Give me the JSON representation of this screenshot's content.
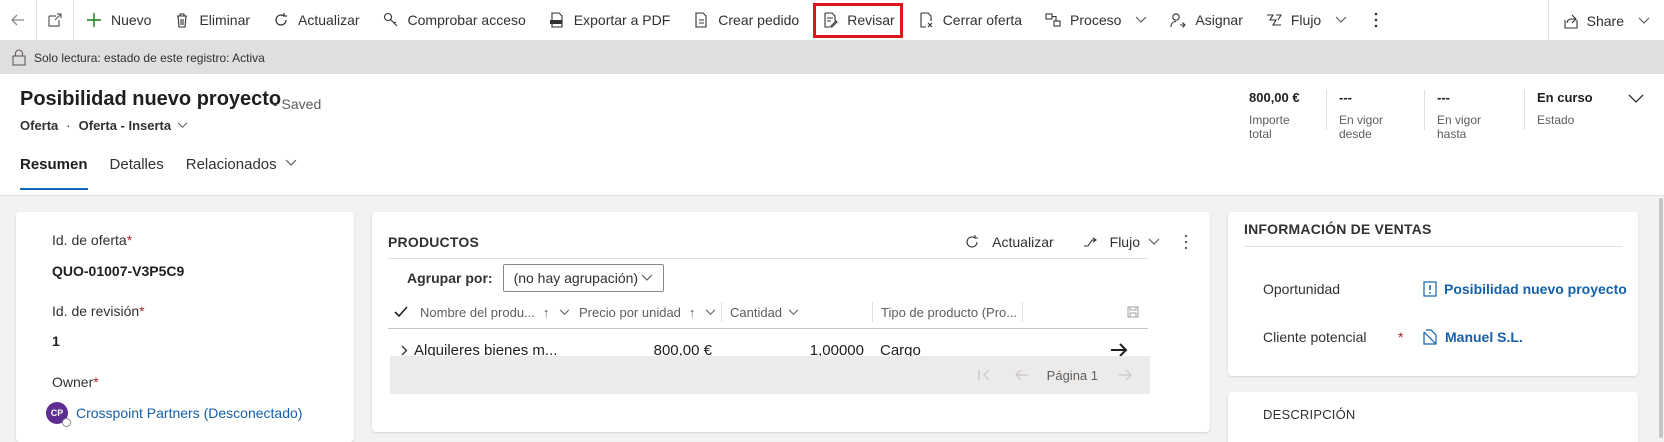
{
  "commandbar": {
    "items": [
      {
        "label": "Nuevo",
        "icon": "plus-icon"
      },
      {
        "label": "Eliminar",
        "icon": "trash-icon"
      },
      {
        "label": "Actualizar",
        "icon": "refresh-icon"
      },
      {
        "label": "Comprobar acceso",
        "icon": "key-icon"
      },
      {
        "label": "Exportar a PDF",
        "icon": "pdf-icon"
      },
      {
        "label": "Crear pedido",
        "icon": "document-icon"
      },
      {
        "label": "Revisar",
        "icon": "edit-document-icon"
      },
      {
        "label": "Cerrar oferta",
        "icon": "close-document-icon"
      },
      {
        "label": "Proceso",
        "icon": "process-icon"
      },
      {
        "label": "Asignar",
        "icon": "person-icon"
      },
      {
        "label": "Flujo",
        "icon": "flow-icon"
      }
    ],
    "share_label": "Share",
    "highlight_color": "#e0141d"
  },
  "readonly_bar": {
    "text": "Solo lectura: estado de este registro: Activa"
  },
  "header": {
    "title": "Posibilidad nuevo proyecto",
    "saved": "- Saved",
    "entity": "Oferta",
    "form": "Oferta - Inserta",
    "fields": [
      {
        "value": "800,00 €",
        "label": "Importe total"
      },
      {
        "value": "---",
        "label": "En vigor desde"
      },
      {
        "value": "---",
        "label": "En vigor hasta"
      },
      {
        "value": "En curso",
        "label": "Estado"
      }
    ],
    "tabs": [
      {
        "label": "Resumen",
        "active": true
      },
      {
        "label": "Detalles",
        "active": false
      },
      {
        "label": "Relacionados",
        "active": false
      }
    ]
  },
  "summary": {
    "quote_id_label": "Id. de oferta",
    "quote_id_value": "QUO-01007-V3P5C9",
    "revision_label": "Id. de revisión",
    "revision_value": "1",
    "owner_label": "Owner",
    "owner_initials": "CP",
    "owner_name": "Crosspoint Partners (Desconectado)",
    "required_mark": "*"
  },
  "products": {
    "title": "PRODUCTOS",
    "refresh_label": "Actualizar",
    "flow_label": "Flujo",
    "group_by_label": "Agrupar por:",
    "group_by_value": "(no hay agrupación)",
    "columns": [
      {
        "label": "Nombre del produ...",
        "sort": "↑"
      },
      {
        "label": "Precio por unidad",
        "sort": "↑"
      },
      {
        "label": "Cantidad",
        "sort": ""
      },
      {
        "label": "Tipo de producto (Pro...",
        "sort": ""
      }
    ],
    "rows": [
      {
        "name": "Alquileres bienes m...",
        "price": "800,00 €",
        "quantity": "1,00000",
        "type": "Cargo"
      }
    ],
    "page_label": "Página 1"
  },
  "sales_info": {
    "title": "INFORMACIÓN DE VENTAS",
    "opportunity_label": "Oportunidad",
    "opportunity_value": "Posibilidad nuevo proyecto",
    "customer_label": "Cliente potencial",
    "customer_value": "Manuel S.L.",
    "required_mark": "*"
  },
  "description": {
    "title": "DESCRIPCIÓN"
  },
  "colors": {
    "link": "#1460aa",
    "accent": "#0f6cbd",
    "avatar": "#5c2e91",
    "required": "#a4262c"
  }
}
